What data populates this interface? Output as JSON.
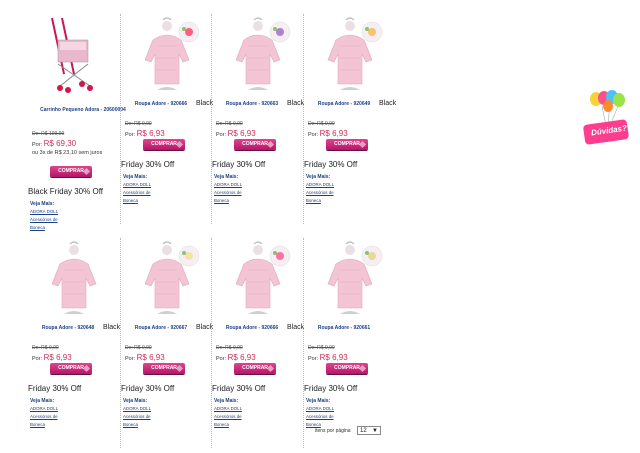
{
  "products": [
    {
      "name": "Carrinho Pequeno Adora - 20600004",
      "black": "",
      "old": "De: R$ 109,00",
      "price_prefix": "Por:",
      "price": "R$ 69,30",
      "installments": "ou 3x de R$ 23,10 sem juros",
      "buy": "COMPRAR",
      "promo": "Black Friday 30% Off",
      "veja": "Veja Mais:",
      "links": [
        "ADORA DOLL",
        "Acessórios de",
        "Boneca"
      ],
      "badge_color": "#f5a6c6",
      "kind": "stroller"
    },
    {
      "name": "Roupa Adore - 920666",
      "black": "Black",
      "old": "De: R$ 9,90",
      "price_prefix": "Por:",
      "price": "R$ 6,93",
      "installments": "",
      "buy": "COMPRAR",
      "promo": "Friday 30% Off",
      "veja": "Veja Mais:",
      "links": [
        "ADORA DOLL",
        "Acessórios de",
        "Boneca"
      ],
      "badge_color": "#ff5f7e",
      "kind": "clothes"
    },
    {
      "name": "Roupa Adore - 920663",
      "black": "Black",
      "old": "De: R$ 9,90",
      "price_prefix": "Por:",
      "price": "R$ 6,93",
      "installments": "",
      "buy": "COMPRAR",
      "promo": "Friday 30% Off",
      "veja": "Veja Mais:",
      "links": [
        "ADORA DOLL",
        "Acessórios de",
        "Boneca"
      ],
      "badge_color": "#b07fcf",
      "kind": "clothes"
    },
    {
      "name": "Roupa Adore - 920649",
      "black": "Black",
      "old": "De: R$ 9,90",
      "price_prefix": "Por:",
      "price": "R$ 6,93",
      "installments": "",
      "buy": "COMPRAR",
      "promo": "Friday 30% Off",
      "veja": "Veja Mais:",
      "links": [
        "ADORA DOLL",
        "Acessórios de",
        "Boneca"
      ],
      "badge_color": "#f5c36b",
      "kind": "clothes"
    },
    {
      "name": "Roupa Adore - 920648",
      "black": "Black",
      "old": "De: R$ 9,90",
      "price_prefix": "Por:",
      "price": "R$ 6,93",
      "installments": "",
      "buy": "COMPRAR",
      "promo": "Friday 30% Off",
      "veja": "Veja Mais:",
      "links": [
        "ADORA DOLL",
        "Acessórios de",
        "Boneca"
      ],
      "badge_color": "",
      "kind": "clothes"
    },
    {
      "name": "Roupa Adore - 920667",
      "black": "Black",
      "old": "De: R$ 9,90",
      "price_prefix": "Por:",
      "price": "R$ 6,93",
      "installments": "",
      "buy": "COMPRAR",
      "promo": "Friday 30% Off",
      "veja": "Veja Mais:",
      "links": [
        "ADORA DOLL",
        "Acessórios de",
        "Boneca"
      ],
      "badge_color": "#f4e3a7",
      "kind": "clothes"
    },
    {
      "name": "Roupa Adore - 920666",
      "black": "Black",
      "old": "De: R$ 9,90",
      "price_prefix": "Por:",
      "price": "R$ 6,93",
      "installments": "",
      "buy": "COMPRAR",
      "promo": "Friday 30% Off",
      "veja": "Veja Mais:",
      "links": [
        "ADORA DOLL",
        "Acessórios de",
        "Boneca"
      ],
      "badge_color": "#ff6fa0",
      "kind": "clothes"
    },
    {
      "name": "Roupa Adore - 920661",
      "black": "",
      "old": "De: R$ 9,90",
      "price_prefix": "Por:",
      "price": "R$ 6,93",
      "installments": "",
      "buy": "COMPRAR",
      "promo": "Friday 30% Off",
      "veja": "Veja Mais:",
      "links": [
        "ADORA DOLL",
        "Acessórios de",
        "Boneca"
      ],
      "badge_color": "#e8d89a",
      "kind": "clothes"
    }
  ],
  "pager": {
    "label": "itens por página",
    "value": "12"
  },
  "help": {
    "label": "Dúvidas?"
  },
  "colors": {
    "accent": "#c8175f",
    "link": "#1b3f86",
    "price": "#d12f5a"
  }
}
